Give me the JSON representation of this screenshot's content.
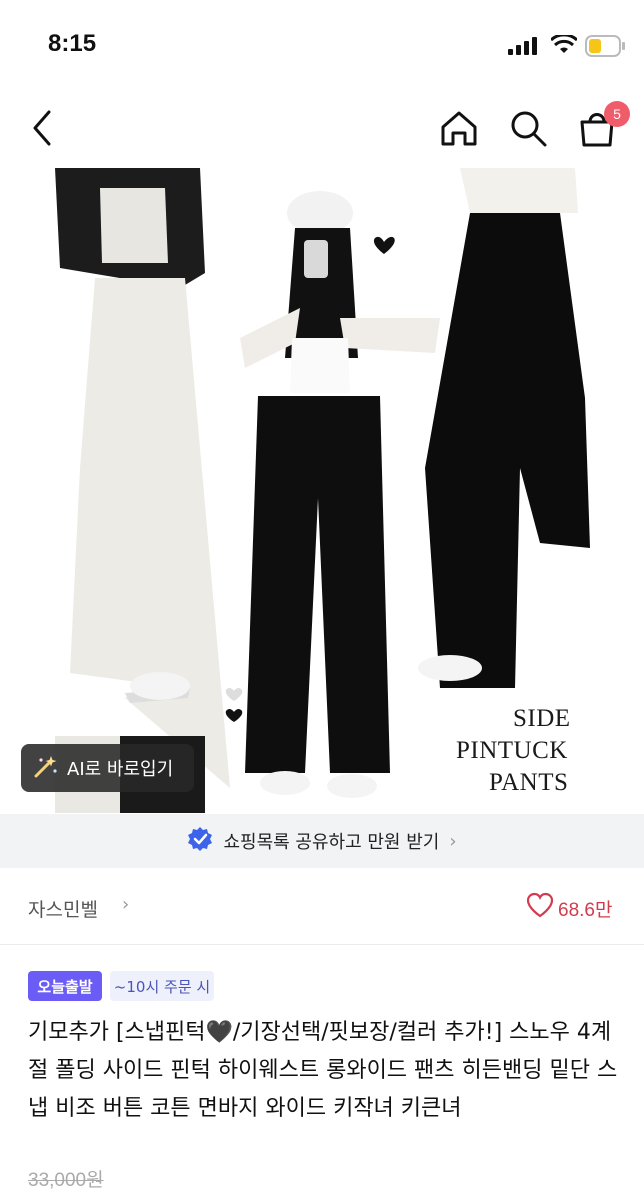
{
  "status_bar": {
    "time": "8:15"
  },
  "nav": {
    "cart_count": "5"
  },
  "hero": {
    "overlay_text": [
      "SIDE",
      "PINTUCK",
      "PANTS"
    ],
    "ai_button_label": "AI로 바로입기"
  },
  "share_banner": {
    "label": "쇼핑목록 공유하고 만원 받기"
  },
  "seller": {
    "name": "자스민벨",
    "likes": "68.6만"
  },
  "badges": {
    "delivery": "오늘출발",
    "cutoff": "~10시 주문 시"
  },
  "product": {
    "title": "기모추가 [스냅핀턱🖤/기장선택/핏보장/컬러 추가!] 스노우 4계절 폴딩 사이드 핀턱 하이웨스트 롱와이드 팬츠 히든밴딩 밑단 스냅 비조 버튼 코튼 면바지 와이드 키작녀 키큰녀",
    "original_price": "33,000원"
  },
  "colors": {
    "accent": "#f05c6a",
    "badge_purple": "#6b5cf6",
    "like_red": "#d33b4e"
  }
}
